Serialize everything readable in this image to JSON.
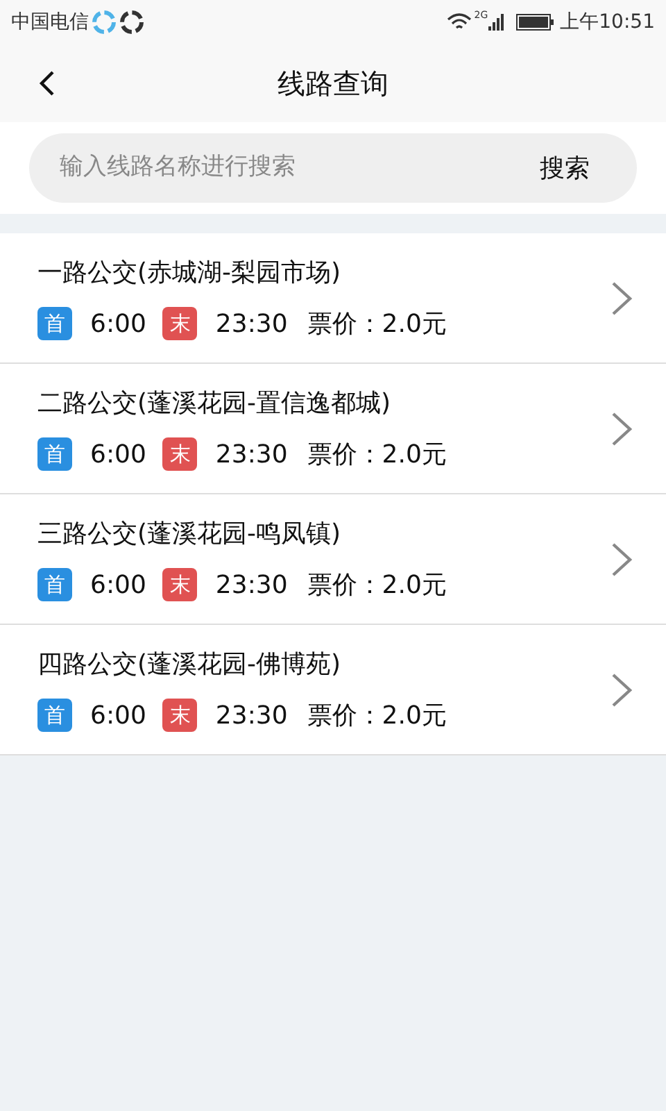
{
  "status_bar": {
    "carrier": "中国电信",
    "network": "2G",
    "time": "上午10:51"
  },
  "header": {
    "title": "线路查询"
  },
  "search": {
    "placeholder": "输入线路名称进行搜索",
    "button": "搜索"
  },
  "routes": [
    {
      "name": "一路公交(赤城湖-梨园市场)",
      "badges": [
        {
          "label": "首",
          "kind": "first",
          "time": "6:00"
        },
        {
          "label": "末",
          "kind": "last",
          "time": "23:30"
        }
      ],
      "fare": "票价：2.0元"
    },
    {
      "name": "二路公交(蓬溪花园-置信逸都城)",
      "badges": [
        {
          "label": "首",
          "kind": "first",
          "time": "6:00"
        },
        {
          "label": "末",
          "kind": "last",
          "time": "23:30"
        }
      ],
      "fare": "票价：2.0元"
    },
    {
      "name": "三路公交(蓬溪花园-鸣凤镇)",
      "badges": [
        {
          "label": "首",
          "kind": "first",
          "time": "6:00"
        },
        {
          "label": "末",
          "kind": "last",
          "time": "23:30"
        }
      ],
      "fare": "票价：2.0元"
    },
    {
      "name": "四路公交(蓬溪花园-佛博苑)",
      "badges": [
        {
          "label": "首",
          "kind": "first",
          "time": "6:00"
        },
        {
          "label": "末",
          "kind": "last",
          "time": "23:30"
        }
      ],
      "fare": "票价：2.0元"
    }
  ]
}
